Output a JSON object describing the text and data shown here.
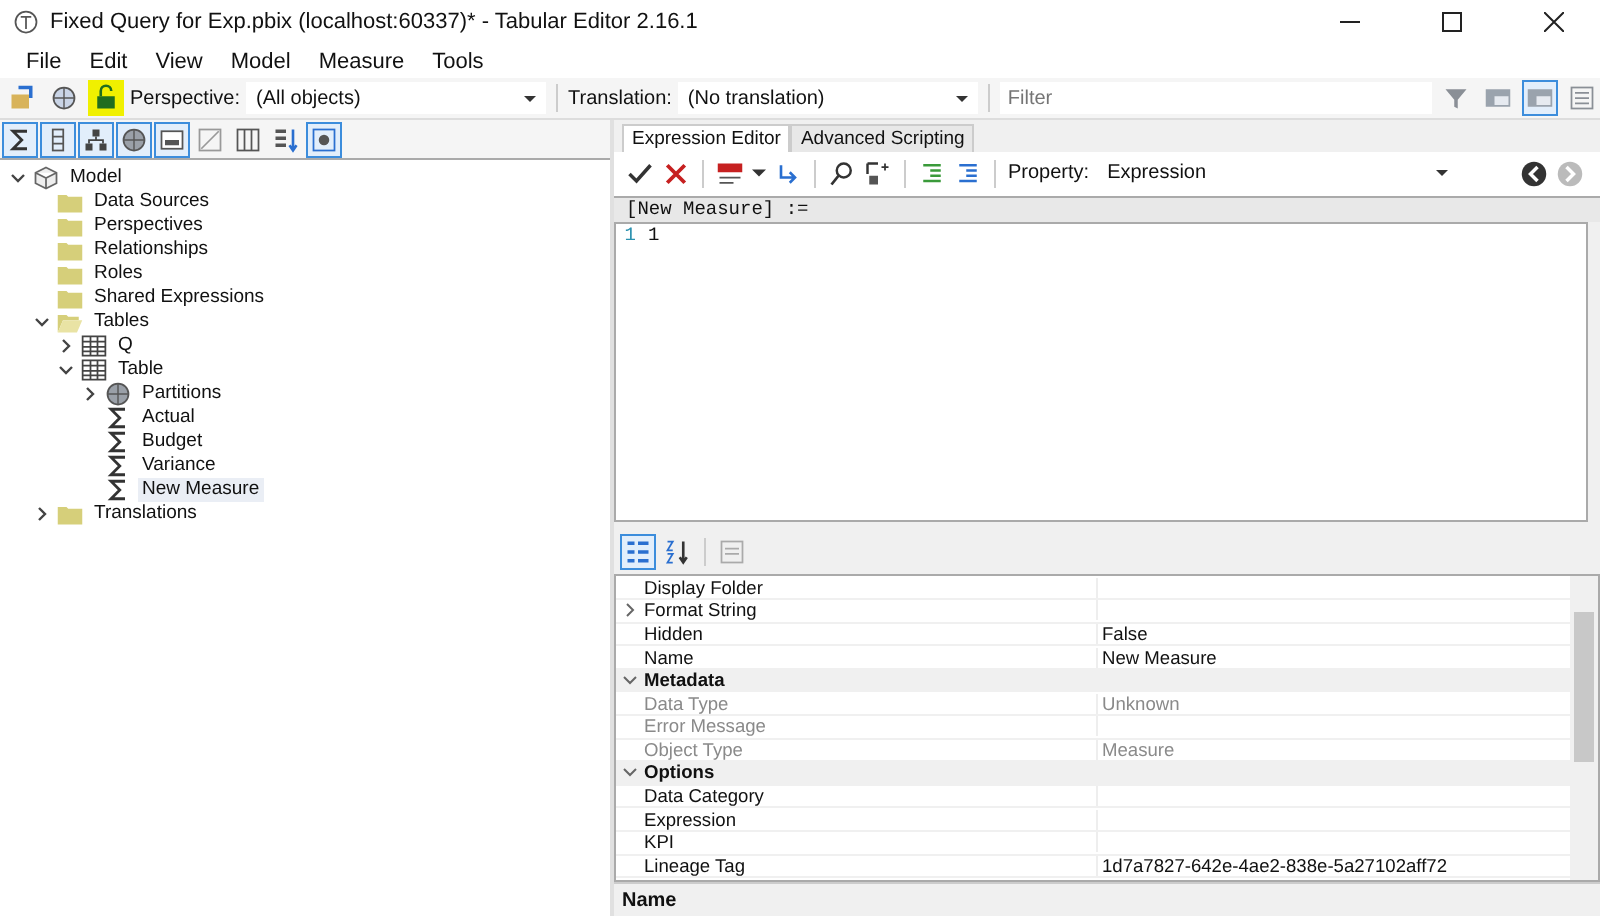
{
  "window": {
    "title": "Fixed Query for Exp.pbix (localhost:60337)* - Tabular Editor 2.16.1"
  },
  "menu": [
    "File",
    "Edit",
    "View",
    "Model",
    "Measure",
    "Tools"
  ],
  "toolbar": {
    "buttons": [
      {
        "kind": "open",
        "highlighted": false
      },
      {
        "kind": "deploy",
        "highlighted": false
      },
      {
        "kind": "save",
        "highlighted": true
      }
    ],
    "perspective_label": "Perspective:",
    "perspective": "(All objects)",
    "translation_label": "Translation:",
    "translation": "(No translation)",
    "filter_placeholder": "Filter",
    "view_buttons": [
      {
        "kind": "filter",
        "on": false
      },
      {
        "kind": "panel",
        "on": false
      },
      {
        "kind": "panel",
        "on": true
      },
      {
        "kind": "list",
        "on": false
      }
    ]
  },
  "tree_toolbar": [
    {
      "kind": "sigma",
      "on": true
    },
    {
      "kind": "column",
      "on": true
    },
    {
      "kind": "hierarchy",
      "on": true
    },
    {
      "kind": "partition",
      "on": true
    },
    {
      "kind": "window",
      "on": true
    },
    {
      "kind": "blank",
      "on": false
    },
    {
      "kind": "columns",
      "on": false
    },
    {
      "kind": "sort",
      "on": false
    },
    {
      "kind": "meta",
      "on": true
    }
  ],
  "tree": [
    {
      "label": "Model",
      "kind": "model",
      "expanded": true,
      "selected": false,
      "children": [
        {
          "label": "Data Sources",
          "kind": "folder",
          "selected": false
        },
        {
          "label": "Perspectives",
          "kind": "folder",
          "selected": false
        },
        {
          "label": "Relationships",
          "kind": "folder",
          "selected": false
        },
        {
          "label": "Roles",
          "kind": "folder",
          "selected": false
        },
        {
          "label": "Shared Expressions",
          "kind": "folder",
          "selected": false
        },
        {
          "label": "Tables",
          "kind": "folder-open",
          "expanded": true,
          "selected": false,
          "children": [
            {
              "label": "Q",
              "kind": "table",
              "expanded": false,
              "selected": false
            },
            {
              "label": "Table",
              "kind": "table",
              "expanded": true,
              "selected": false,
              "children": [
                {
                  "label": "Partitions",
                  "kind": "partition",
                  "expanded": false,
                  "selected": false
                },
                {
                  "label": "Actual",
                  "kind": "measure",
                  "selected": false
                },
                {
                  "label": "Budget",
                  "kind": "measure",
                  "selected": false
                },
                {
                  "label": "Variance",
                  "kind": "measure",
                  "selected": false
                },
                {
                  "label": "New Measure",
                  "kind": "measure",
                  "selected": true
                }
              ]
            }
          ]
        },
        {
          "label": "Translations",
          "kind": "folder",
          "expanded": false,
          "selected": false
        }
      ]
    }
  ],
  "editor": {
    "tabs": [
      {
        "label": "Expression Editor",
        "selected": true
      },
      {
        "label": "Advanced Scripting",
        "selected": false
      }
    ],
    "property_label": "Property:",
    "property": "Expression",
    "header": "[New Measure] :=",
    "lines": [
      {
        "number": "1",
        "code": "1"
      }
    ]
  },
  "properties": {
    "rows": [
      {
        "kind": "property",
        "name": "Display Folder",
        "value": "",
        "disabled": false
      },
      {
        "kind": "property",
        "name": "Format String",
        "value": "",
        "disabled": false,
        "expanded": false
      },
      {
        "kind": "property",
        "name": "Hidden",
        "value": "False",
        "disabled": false
      },
      {
        "kind": "property",
        "name": "Name",
        "value": "New Measure",
        "disabled": false
      },
      {
        "kind": "category",
        "name": "Metadata",
        "expanded": true
      },
      {
        "kind": "property",
        "name": "Data Type",
        "value": "Unknown",
        "disabled": true
      },
      {
        "kind": "property",
        "name": "Error Message",
        "value": "",
        "disabled": true
      },
      {
        "kind": "property",
        "name": "Object Type",
        "value": "Measure",
        "disabled": true
      },
      {
        "kind": "category",
        "name": "Options",
        "expanded": true
      },
      {
        "kind": "property",
        "name": "Data Category",
        "value": "",
        "disabled": false
      },
      {
        "kind": "property",
        "name": "Expression",
        "value": "",
        "disabled": false
      },
      {
        "kind": "property",
        "name": "KPI",
        "value": "",
        "disabled": false
      },
      {
        "kind": "property",
        "name": "Lineage Tag",
        "value": "1d7a7827-642e-4ae2-838e-5a27102aff72",
        "disabled": false
      }
    ],
    "description_title": "Name"
  }
}
